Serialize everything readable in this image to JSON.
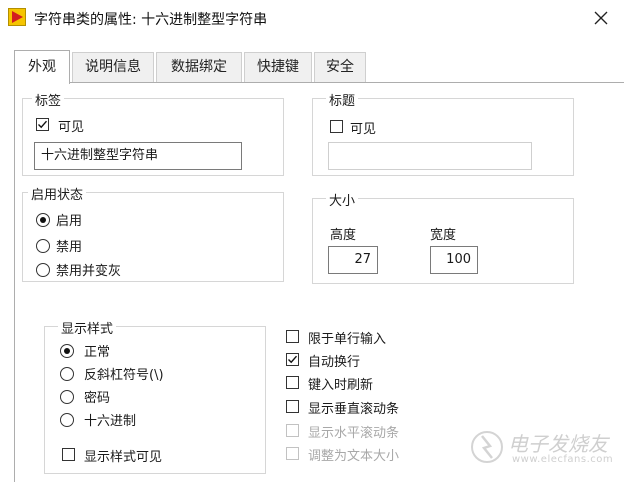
{
  "window": {
    "title": "字符串类的属性: 十六进制整型字符串"
  },
  "tabs": [
    {
      "label": "外观",
      "active": true
    },
    {
      "label": "说明信息"
    },
    {
      "label": "数据绑定"
    },
    {
      "label": "快捷键"
    },
    {
      "label": "安全"
    }
  ],
  "label_group": {
    "legend": "标签",
    "visible_label": "可见",
    "visible_checked": true,
    "text_value": "十六进制整型字符串"
  },
  "caption_group": {
    "legend": "标题",
    "visible_label": "可见",
    "visible_checked": false,
    "text_value": ""
  },
  "enable_state": {
    "legend": "启用状态",
    "options": [
      "启用",
      "禁用",
      "禁用并变灰"
    ],
    "selected": 0
  },
  "size_group": {
    "legend": "大小",
    "height_label": "高度",
    "height_value": "27",
    "width_label": "宽度",
    "width_value": "100"
  },
  "display_style": {
    "legend": "显示样式",
    "options": [
      "正常",
      "反斜杠符号(\\)",
      "密码",
      "十六进制"
    ],
    "selected": 0,
    "visible_label": "显示样式可见",
    "visible_checked": false
  },
  "options": [
    {
      "label": "限于单行输入",
      "checked": false,
      "disabled": false
    },
    {
      "label": "自动换行",
      "checked": true,
      "disabled": false
    },
    {
      "label": "键入时刷新",
      "checked": false,
      "disabled": false
    },
    {
      "label": "显示垂直滚动条",
      "checked": false,
      "disabled": false
    },
    {
      "label": "显示水平滚动条",
      "checked": false,
      "disabled": true
    },
    {
      "label": "调整为文本大小",
      "checked": false,
      "disabled": true
    }
  ],
  "watermark": {
    "text": "电子发烧友",
    "sub": "www.elecfans.com"
  }
}
